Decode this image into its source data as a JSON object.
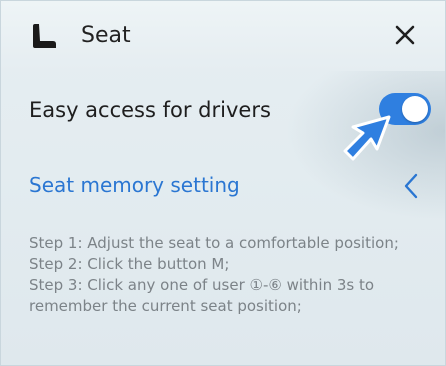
{
  "header": {
    "title": "Seat",
    "seat_icon": "seat-icon",
    "close_icon": "close-icon"
  },
  "easy_access": {
    "label": "Easy access for drivers",
    "enabled": true,
    "toggle_color": "#2f7fe0"
  },
  "seat_memory": {
    "label": "Seat memory setting",
    "label_color": "#2a76d2",
    "chevron_icon": "chevron-left-icon"
  },
  "steps": [
    "Step 1: Adjust the seat to a comfortable position;",
    "Step 2: Click the button M;",
    "Step 3: Click any one of user ①-⑥ within 3s to remember the current seat position;"
  ],
  "pointer_icon": "pointer-arrow-icon"
}
